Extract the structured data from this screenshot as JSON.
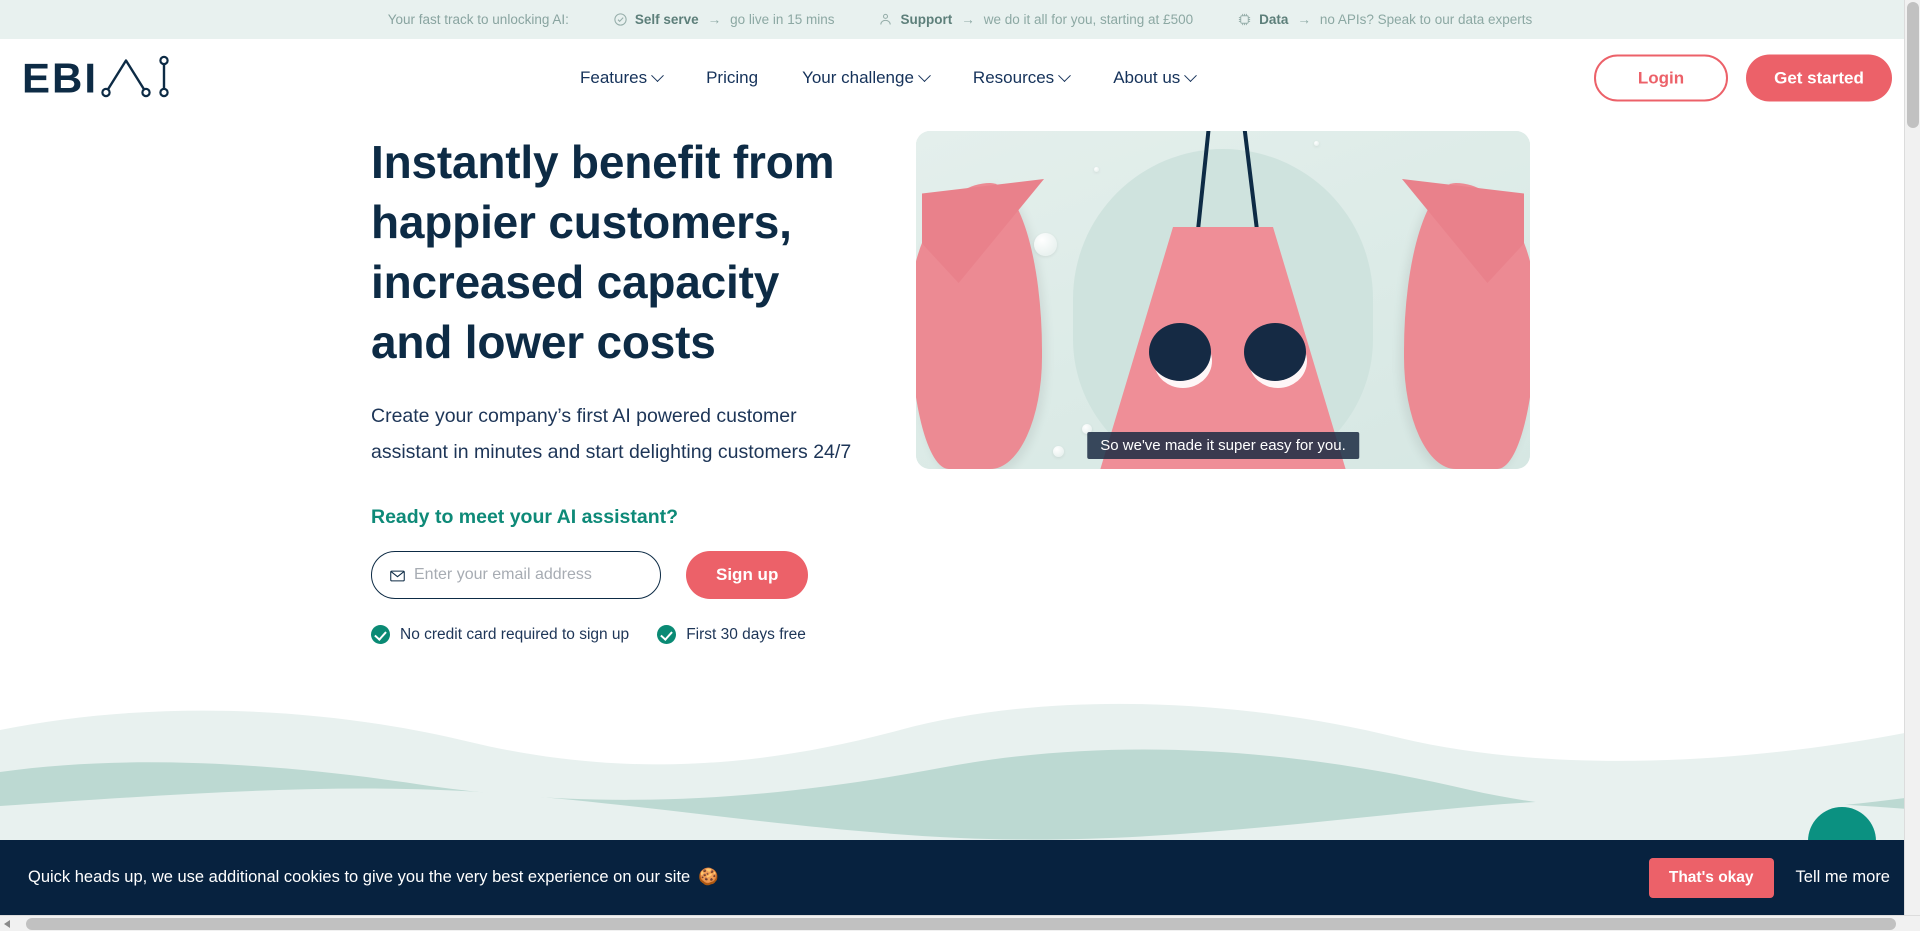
{
  "promo": {
    "lead": "Your fast track to unlocking AI:",
    "items": [
      {
        "icon": "check-circle-icon",
        "strong": "Self serve",
        "arrow": "→",
        "rest": "go live in 15 mins"
      },
      {
        "icon": "support-agent-icon",
        "strong": "Support",
        "arrow": "→",
        "rest": "we do it all for you, starting at £500"
      },
      {
        "icon": "api-data-icon",
        "strong": "Data",
        "arrow": "→",
        "rest": "no APIs? Speak to our data experts"
      }
    ]
  },
  "header": {
    "logo_text": "EBI",
    "logo_alt": "EBI.AI",
    "nav": [
      {
        "label": "Features",
        "has_dropdown": true
      },
      {
        "label": "Pricing",
        "has_dropdown": false
      },
      {
        "label": "Your challenge",
        "has_dropdown": true
      },
      {
        "label": "Resources",
        "has_dropdown": true
      },
      {
        "label": "About us",
        "has_dropdown": true
      }
    ],
    "login_label": "Login",
    "get_started_label": "Get started"
  },
  "hero": {
    "title": "Instantly benefit from happier customers, increased capacity and lower costs",
    "subtitle": "Create your company’s first AI powered customer assistant in minutes and start delighting customers 24/7",
    "cta_heading": "Ready to meet your AI assistant?",
    "email_placeholder": "Enter your email address",
    "email_value": "",
    "signup_label": "Sign up",
    "perks": [
      "No credit card required to sign up",
      "First 30 days free"
    ],
    "media_caption": "So we've made it super easy for you."
  },
  "chat": {
    "fab_label": "chat-widget-button"
  },
  "cookie": {
    "message": "Quick heads up, we use additional cookies to give you the very best experience on our site",
    "emoji": "🍪",
    "accept_label": "That's okay",
    "more_label": "Tell me more"
  },
  "colors": {
    "brand_navy": "#0d2b45",
    "brand_coral": "#ec6169",
    "brand_teal": "#0a8a74",
    "promo_bg": "#e8f1ef",
    "wave_light": "#e8f1ef",
    "wave_dark": "#bcd9d2",
    "cookie_bg": "#07223f"
  }
}
